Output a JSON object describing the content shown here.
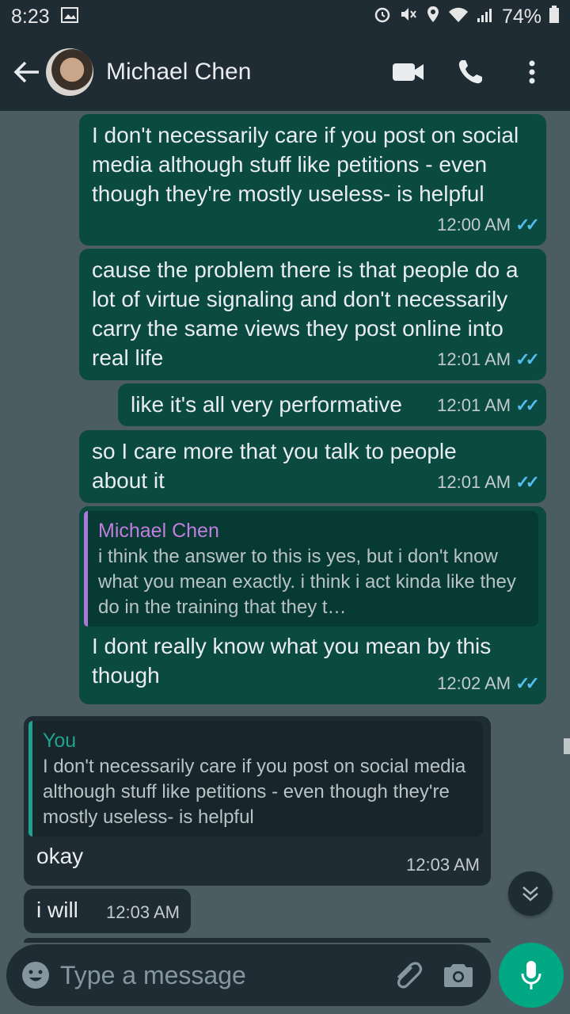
{
  "status_bar": {
    "time": "8:23",
    "battery": "74%"
  },
  "header": {
    "contact_name": "Michael Chen"
  },
  "messages": [
    {
      "dir": "out",
      "text": "I don't necessarily care if you post on social media although stuff like petitions - even though they're mostly useless- is helpful",
      "time": "12:00 AM",
      "read": true
    },
    {
      "dir": "out",
      "text": "cause the problem there is that people do a lot of virtue signaling and don't necessarily carry the same views they post online into real life",
      "time": "12:01 AM",
      "read": true
    },
    {
      "dir": "out",
      "text": "like it's all very performative",
      "time": "12:01 AM",
      "read": true
    },
    {
      "dir": "out",
      "text": "so I care more that you talk to people about it",
      "time": "12:01 AM",
      "read": true
    },
    {
      "dir": "out",
      "quote": {
        "name": "Michael Chen",
        "text": "i think the answer to this is yes, but i don't know what you mean exactly. i think i act kinda like they do in the training that they t…"
      },
      "text": "I dont really know what you mean by this though",
      "time": "12:02 AM",
      "read": true
    },
    {
      "dir": "in",
      "quote": {
        "name": "You",
        "text": "I don't necessarily care if you post on social media although stuff like petitions - even though they're mostly useless- is helpful"
      },
      "text": "okay",
      "time": "12:03 AM"
    },
    {
      "dir": "in",
      "text": "i will",
      "time": "12:03 AM"
    }
  ],
  "input": {
    "placeholder": "Type a message"
  },
  "colors": {
    "outgoing_bubble": "#0a4a40",
    "incoming_bubble": "#1f2c33",
    "chat_background": "#4b5d63",
    "accent": "#00a884",
    "read_ticks": "#53bdeb"
  },
  "icons": [
    "back-arrow-icon",
    "video-call-icon",
    "phone-icon",
    "more-options-icon",
    "emoji-icon",
    "attach-icon",
    "camera-icon",
    "mic-icon",
    "scroll-down-icon"
  ]
}
